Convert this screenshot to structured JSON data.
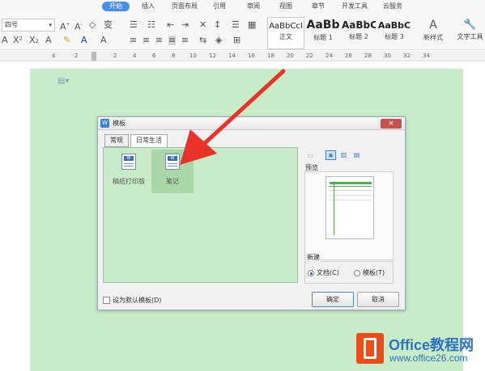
{
  "menu": {
    "tabs": [
      "开始",
      "插入",
      "页面布局",
      "引用",
      "审阅",
      "视图",
      "章节",
      "开发工具",
      "云服务"
    ],
    "active": "开始"
  },
  "toolbar": {
    "font_size": "四号",
    "styles": [
      {
        "sample": "AaBbCcI",
        "label": "正文"
      },
      {
        "sample": "AaBb",
        "label": "标题 1"
      },
      {
        "sample": "AaBbC",
        "label": "标题 2"
      },
      {
        "sample": "AaBbC",
        "label": "标题 3"
      }
    ],
    "new_style_label": "新样式",
    "text_tools_label": "文字工具"
  },
  "ruler": {
    "numbers": [
      "4",
      "2",
      "2",
      "4",
      "6",
      "8",
      "10",
      "12",
      "14",
      "16",
      "18",
      "20",
      "22",
      "24",
      "26",
      "28",
      "30",
      "32",
      "34"
    ]
  },
  "dialog": {
    "title": "模板",
    "close_label": "×",
    "tabs": [
      "常规",
      "日常生活"
    ],
    "active_tab": "日常生活",
    "templates": [
      {
        "label": "稿纸打印版",
        "selected": false
      },
      {
        "label": "笔记",
        "selected": true
      }
    ],
    "preview_label": "预览",
    "new_group_label": "新建",
    "new_options": [
      {
        "label": "文档(C)",
        "checked": true
      },
      {
        "label": "模板(T)",
        "checked": false
      }
    ],
    "set_default_label": "设为默认模板(D)",
    "set_default_checked": false,
    "ok_label": "确定",
    "cancel_label": "取消"
  },
  "watermark": {
    "brand": "Office教程网",
    "url": "www.office26.com"
  },
  "colors": {
    "page_background": "#c8ecc8",
    "accent_tab": "#4a8ee8",
    "arrow": "#e8322a",
    "watermark_logo": "#e94e19",
    "watermark_text": "#2e72c0"
  }
}
